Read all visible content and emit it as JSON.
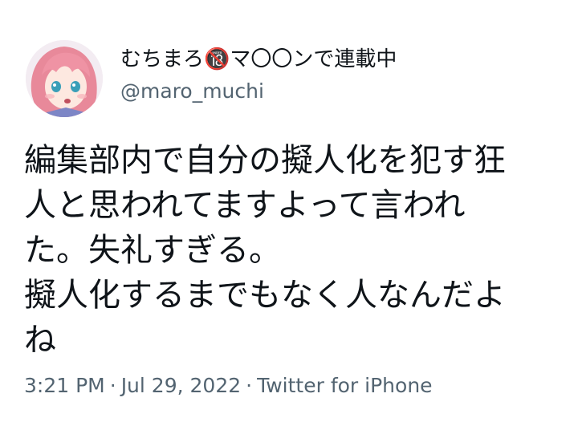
{
  "author": {
    "display_name": "むちまろ🔞マ〇〇ンで連載中",
    "handle": "@maro_muchi"
  },
  "tweet": {
    "lines": [
      "編集部内で自分の擬人化を犯す狂",
      "人と思われてますよって言われ",
      "た。失礼すぎる。",
      "擬人化するまでもなく人なんだよ",
      "ね"
    ]
  },
  "meta": {
    "time": "3:21 PM",
    "date": "Jul 29, 2022",
    "source": "Twitter for iPhone",
    "separator": "·"
  },
  "colors": {
    "text_primary": "#0f1419",
    "text_secondary": "#536471",
    "background": "#ffffff"
  }
}
